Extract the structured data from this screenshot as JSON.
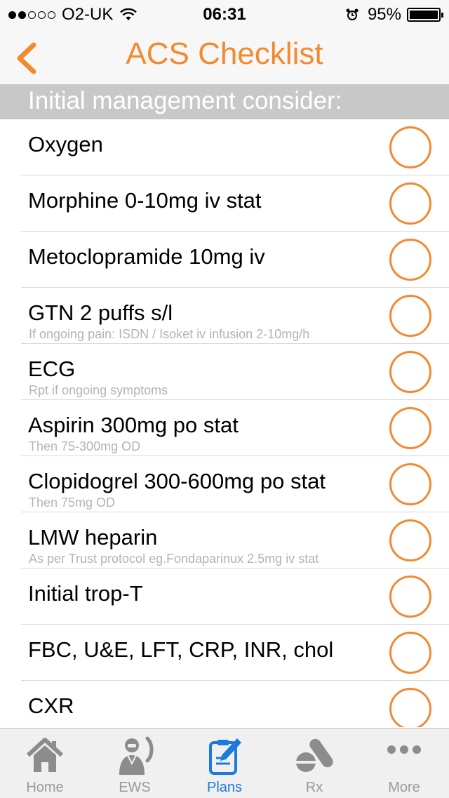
{
  "status_bar": {
    "carrier": "O2-UK",
    "time": "06:31",
    "battery": "95%"
  },
  "nav": {
    "title": "ACS Checklist"
  },
  "section": {
    "header": "Initial management consider:"
  },
  "items": [
    {
      "title": "Oxygen",
      "subtitle": ""
    },
    {
      "title": "Morphine 0-10mg iv stat",
      "subtitle": ""
    },
    {
      "title": "Metoclopramide 10mg iv",
      "subtitle": ""
    },
    {
      "title": "GTN 2 puffs s/l",
      "subtitle": "If ongoing pain: ISDN / Isoket iv infusion 2-10mg/h"
    },
    {
      "title": "ECG",
      "subtitle": "Rpt if ongoing symptoms"
    },
    {
      "title": "Aspirin 300mg po stat",
      "subtitle": "Then 75-300mg OD"
    },
    {
      "title": "Clopidogrel 300-600mg po stat",
      "subtitle": "Then 75mg OD"
    },
    {
      "title": "LMW heparin",
      "subtitle": "As per Trust protocol eg.Fondaparinux 2.5mg iv stat"
    },
    {
      "title": "Initial trop-T",
      "subtitle": ""
    },
    {
      "title": "FBC, U&E, LFT, CRP, INR, chol",
      "subtitle": ""
    },
    {
      "title": "CXR",
      "subtitle": ""
    }
  ],
  "tabs": [
    {
      "label": "Home",
      "icon": "home-icon"
    },
    {
      "label": "EWS",
      "icon": "doctor-phone-icon"
    },
    {
      "label": "Plans",
      "icon": "clipboard-pen-icon"
    },
    {
      "label": "Rx",
      "icon": "pills-icon"
    },
    {
      "label": "More",
      "icon": "more-dots-icon"
    }
  ],
  "active_tab": "Plans",
  "colors": {
    "accent": "#f28a30",
    "active_tab": "#1a7ae0",
    "inactive_tab": "#9a9a9a",
    "section_bg": "#c8c8c8"
  }
}
